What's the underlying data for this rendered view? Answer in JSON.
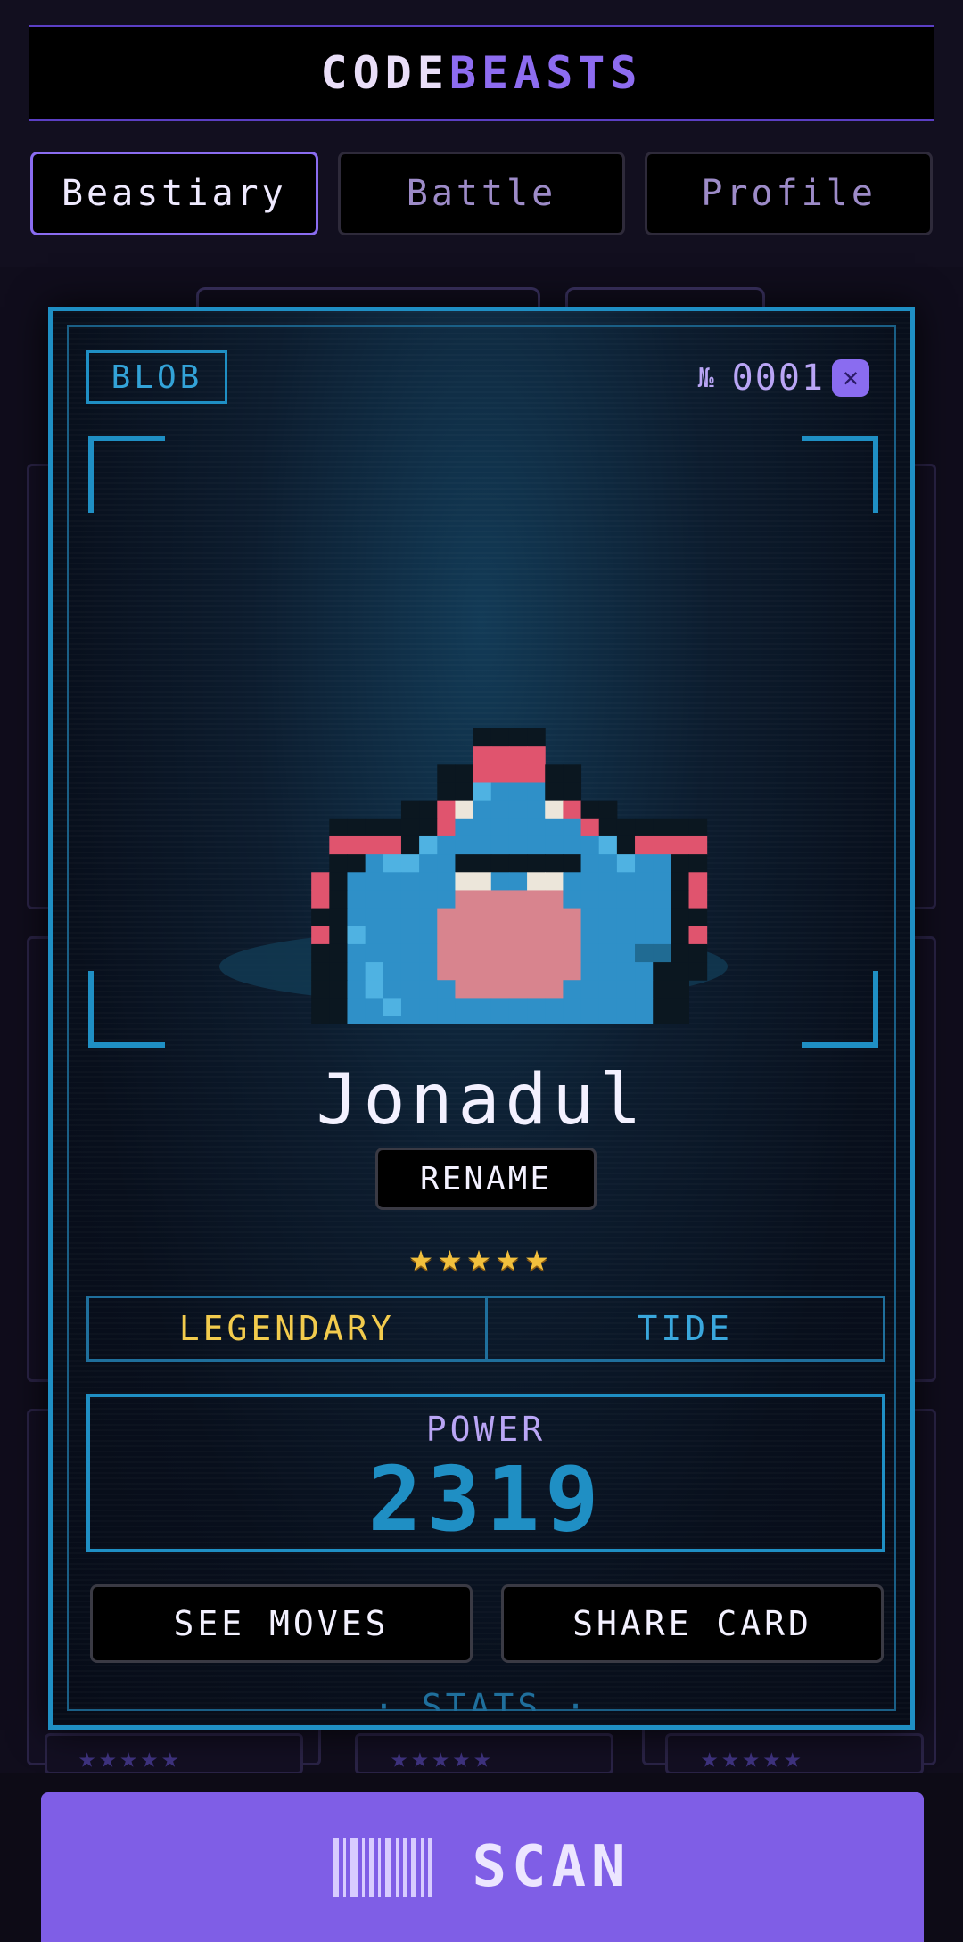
{
  "app": {
    "logo_part1": "CODE",
    "logo_part2": "BEASTS"
  },
  "tabs": [
    {
      "label": "Beastiary",
      "active": true
    },
    {
      "label": "Battle",
      "active": false
    },
    {
      "label": "Profile",
      "active": false
    }
  ],
  "card": {
    "type_tag": "BLOB",
    "dex_label": "№",
    "dex_number": "0001",
    "close_glyph": "✕",
    "name": "Jonadul",
    "rename_label": "RENAME",
    "stars": "★★★★★",
    "star_count": 5,
    "rarity": "LEGENDARY",
    "element": "TIDE",
    "power_label": "POWER",
    "power_value": "2319",
    "see_moves_label": "SEE MOVES",
    "share_card_label": "SHARE CARD",
    "stats_peek": "· STATS ·"
  },
  "background": {
    "row_stars": [
      "★★★★★",
      "★★★★★",
      "★★★★★"
    ]
  },
  "scan": {
    "label": "SCAN",
    "icon": "barcode-icon"
  },
  "colors": {
    "accent_purple": "#8a6cf0",
    "accent_blue": "#1f8fc4",
    "gold": "#f2cb4d",
    "scan_button": "#7f5ee6"
  }
}
